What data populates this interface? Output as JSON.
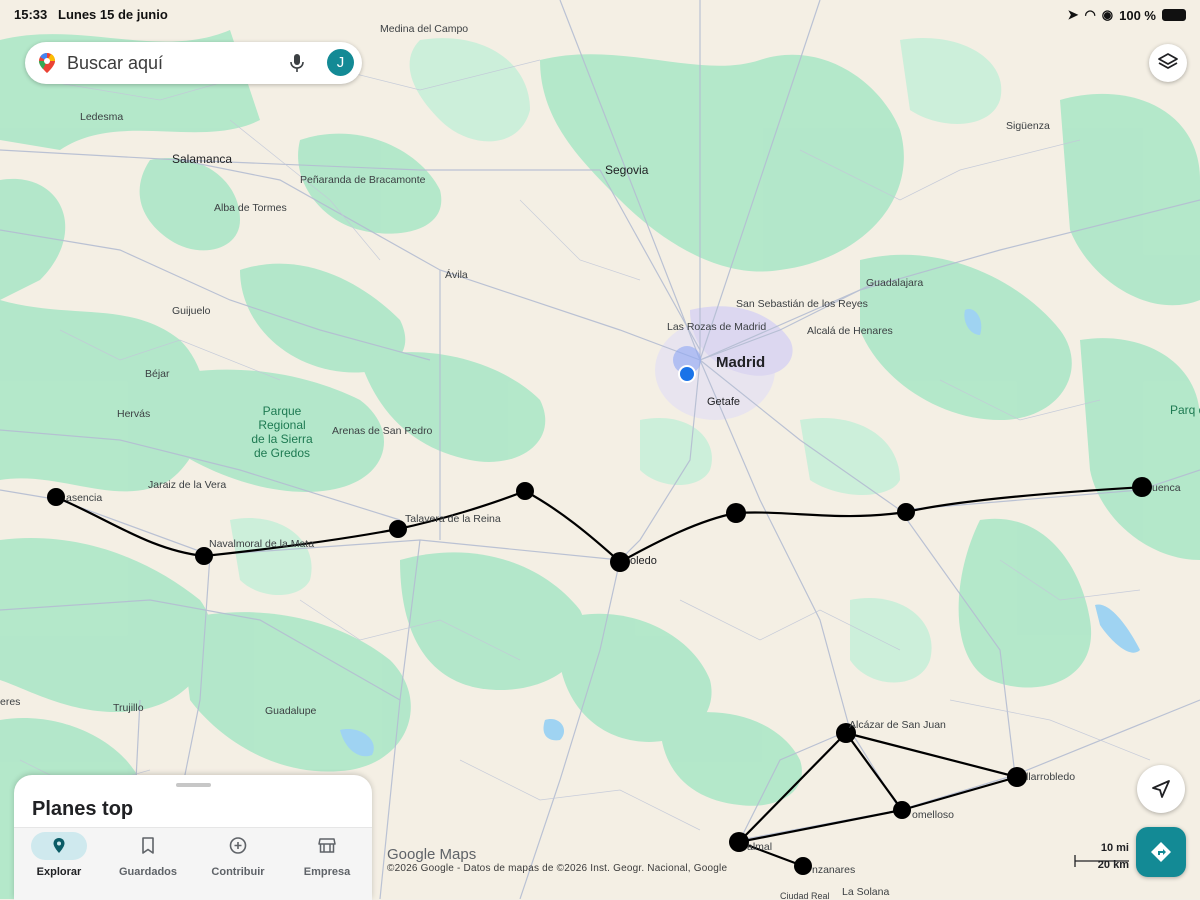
{
  "status": {
    "time": "15:33",
    "date": "Lunes 15 de junio",
    "battery": "100 %"
  },
  "search": {
    "placeholder": "Buscar aquí",
    "avatar_letter": "J"
  },
  "panel": {
    "title": "Planes top",
    "tabs": [
      {
        "label": "Explorar",
        "icon": "pin-icon",
        "active": true
      },
      {
        "label": "Guardados",
        "icon": "bookmark-icon",
        "active": false
      },
      {
        "label": "Contribuir",
        "icon": "plus-circle-icon",
        "active": false
      },
      {
        "label": "Empresa",
        "icon": "store-icon",
        "active": false
      }
    ]
  },
  "map": {
    "logo": "Google Maps",
    "attribution": "©2026 Google - Datos de mapas de ©2026 Inst. Geogr. Nacional, Google",
    "scale_imperial": "10 mi",
    "scale_metric": "20 km",
    "places": {
      "medina": "Medina del Campo",
      "ledesma": "Ledesma",
      "salamanca": "Salamanca",
      "segovia": "Segovia",
      "penaranda": "Peñaranda de Bracamonte",
      "alba": "Alba de Tormes",
      "avila": "Ávila",
      "guijuelo": "Guijuelo",
      "bejar": "Béjar",
      "hervas": "Hervás",
      "parque": "Parque Regional de la Sierra de Gredos",
      "arenas": "Arenas de San Pedro",
      "jaraiz": "Jaraiz de la Vera",
      "plasencia": "asencia",
      "navalmoral": "Navalmoral de la Mata",
      "talavera": "Talavera de la Reina",
      "lasrozas": "Las Rozas de Madrid",
      "madrid": "Madrid",
      "getafe": "Getafe",
      "sansebastian": "San Sebastián de los Reyes",
      "alcala": "Alcalá de Henares",
      "guadalajara": "Guadalajara",
      "siguenza": "Sigüenza",
      "toledo": "oledo",
      "cuenca": "uenca",
      "parque_east": "Parq de la",
      "trujillo": "Trujillo",
      "guadalupe": "Guadalupe",
      "eres": "eres",
      "alcazar": "Alcázar de San Juan",
      "villarrobledo": "llarrobledo",
      "tomelloso": "omelloso",
      "valdepenas": "almal",
      "manzanares": "nzanares",
      "lasolana": "La Solana",
      "ciudadreal": "Ciudad Real"
    }
  },
  "route": {
    "segments": [
      {
        "from": "Plasencia",
        "to": "Navalmoral de la Mata"
      },
      {
        "from": "Navalmoral de la Mata",
        "to": "Talavera de la Reina"
      },
      {
        "from": "Talavera de la Reina",
        "to": "Toledo"
      },
      {
        "from": "Toledo",
        "to": "Cuenca"
      },
      {
        "from": "Alcázar de San Juan",
        "to": "Villarrobledo"
      },
      {
        "from": "Tomelloso",
        "to": "Villarrobledo"
      },
      {
        "from": "Valdepeñas",
        "to": "Alcázar de San Juan"
      },
      {
        "from": "Valdepeñas",
        "to": "Tomelloso"
      }
    ]
  }
}
